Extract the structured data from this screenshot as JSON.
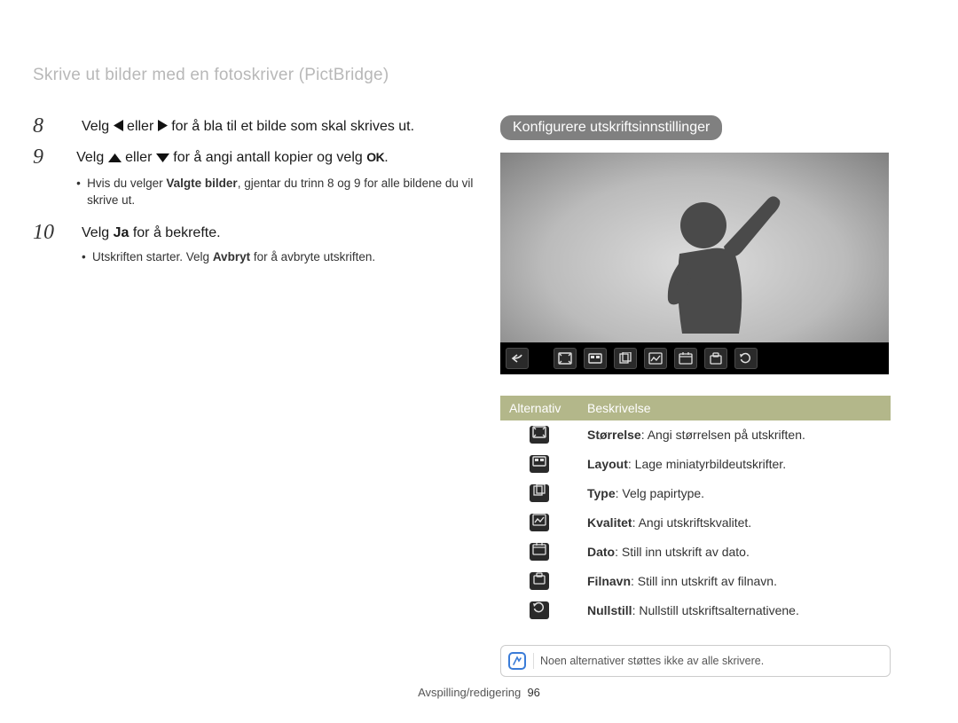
{
  "page_title": "Skrive ut bilder med en fotoskriver (PictBridge)",
  "steps": {
    "s8": {
      "num": "8",
      "pre": "Velg ",
      "mid": " eller ",
      "post": " for å bla til et bilde som skal skrives ut."
    },
    "s9": {
      "num": "9",
      "pre": "Velg ",
      "mid": " eller ",
      "post1": " for å angi antall kopier og velg ",
      "post2": ".",
      "bullet_pre": "Hvis du velger ",
      "bullet_bold": "Valgte bilder",
      "bullet_post": ", gjentar du trinn 8 og 9 for alle bildene du vil skrive ut."
    },
    "s10": {
      "num": "10",
      "pre": "Velg ",
      "bold": "Ja",
      "post": " for å bekrefte.",
      "bullet_pre": "Utskriften starter. Velg ",
      "bullet_bold": "Avbryt",
      "bullet_post": " for å avbryte utskriften."
    }
  },
  "right": {
    "badge": "Konfigurere utskriftsinnstillinger",
    "header": {
      "col1": "Alternativ",
      "col2": "Beskrivelse"
    },
    "rows": [
      {
        "label": "Størrelse",
        "desc": ": Angi størrelsen på utskriften."
      },
      {
        "label": "Layout",
        "desc": ": Lage miniatyrbildeutskrifter."
      },
      {
        "label": "Type",
        "desc": ": Velg papirtype."
      },
      {
        "label": "Kvalitet",
        "desc": ": Angi utskriftskvalitet."
      },
      {
        "label": "Dato",
        "desc": ": Still inn utskrift av dato."
      },
      {
        "label": "Filnavn",
        "desc": ": Still inn utskrift av filnavn."
      },
      {
        "label": "Nullstill",
        "desc": ": Nullstill utskriftsalternativene."
      }
    ],
    "note": "Noen alternativer støttes ikke av alle skrivere."
  },
  "toolbar_icons": [
    "back",
    "size",
    "layout",
    "type",
    "quality",
    "date",
    "filename",
    "reset"
  ],
  "footer": {
    "section": "Avspilling/redigering",
    "page": "96"
  },
  "glyphs": {
    "ok": "OK"
  }
}
